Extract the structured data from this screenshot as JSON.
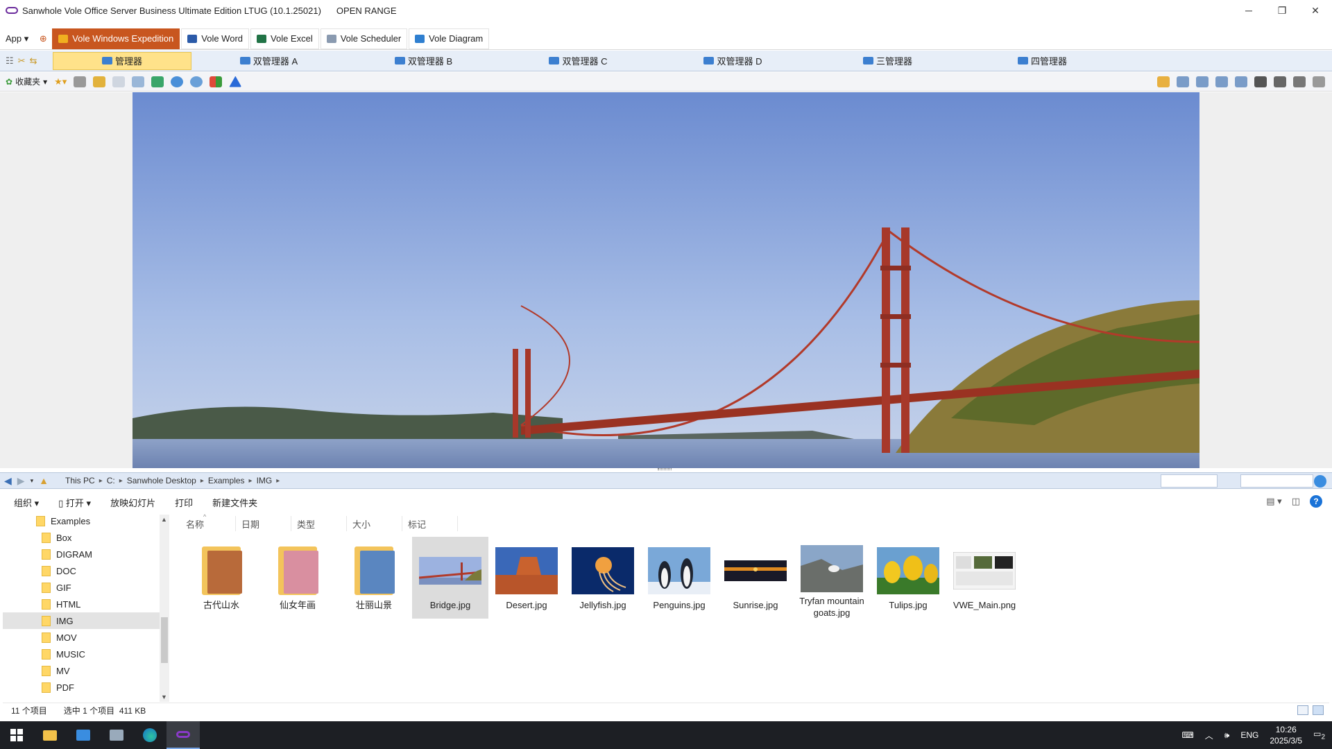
{
  "window": {
    "title": "Sanwhole Vole Office Server Business Ultimate Edition LTUG (10.1.25021)",
    "subtitle": "OPEN RANGE",
    "controls": [
      "─",
      "❐",
      "✕"
    ]
  },
  "ribbon": {
    "app_label": "App",
    "tabs": [
      {
        "label": "Vole Windows Expedition",
        "active": true,
        "color": "#f0b020"
      },
      {
        "label": "Vole Word",
        "active": false,
        "color": "#2b5aa8"
      },
      {
        "label": "Vole Excel",
        "active": false,
        "color": "#217346"
      },
      {
        "label": "Vole Scheduler",
        "active": false,
        "color": "#8a9ab0"
      },
      {
        "label": "Vole Diagram",
        "active": false,
        "color": "#2f7fd0"
      }
    ]
  },
  "managers": [
    {
      "label": "管理器",
      "active": true
    },
    {
      "label": "双管理器 A",
      "active": false
    },
    {
      "label": "双管理器 B",
      "active": false
    },
    {
      "label": "双管理器 C",
      "active": false
    },
    {
      "label": "双管理器 D",
      "active": false
    },
    {
      "label": "三管理器",
      "active": false
    },
    {
      "label": "四管理器",
      "active": false
    }
  ],
  "toolbar": {
    "favorites_label": "收藏夹"
  },
  "address": {
    "crumbs": [
      "This PC",
      "C:",
      "Sanwhole Desktop",
      "Examples",
      "IMG"
    ]
  },
  "commands": {
    "organize": "组织",
    "open": "打开",
    "slideshow": "放映幻灯片",
    "print": "打印",
    "new_folder": "新建文件夹"
  },
  "tree": {
    "root": "Examples",
    "items": [
      "Box",
      "DIGRAM",
      "DOC",
      "GIF",
      "HTML",
      "IMG",
      "MOV",
      "MUSIC",
      "MV",
      "PDF"
    ],
    "selected": "IMG"
  },
  "columns": [
    "名称",
    "日期",
    "类型",
    "大小",
    "标记"
  ],
  "files": [
    {
      "name": "古代山水",
      "kind": "folder",
      "color": "#b86a3a"
    },
    {
      "name": "仙女年画",
      "kind": "folder",
      "color": "#d98fa0"
    },
    {
      "name": "壮丽山景",
      "kind": "folder",
      "color": "#5a86c0"
    },
    {
      "name": "Bridge.jpg",
      "kind": "bridge",
      "selected": true
    },
    {
      "name": "Desert.jpg",
      "kind": "desert"
    },
    {
      "name": "Jellyfish.jpg",
      "kind": "jellyfish"
    },
    {
      "name": "Penguins.jpg",
      "kind": "penguins"
    },
    {
      "name": "Sunrise.jpg",
      "kind": "sunrise"
    },
    {
      "name": "Tryfan mountain goats.jpg",
      "kind": "goats"
    },
    {
      "name": "Tulips.jpg",
      "kind": "tulips"
    },
    {
      "name": "VWE_Main.png",
      "kind": "screen"
    }
  ],
  "status": {
    "count": "11 个项目",
    "selection": "选中 1 个项目",
    "size": "411 KB"
  },
  "taskbar": {
    "lang": "ENG",
    "time": "10:26",
    "date": "2025/3/5",
    "notifications": "2"
  }
}
